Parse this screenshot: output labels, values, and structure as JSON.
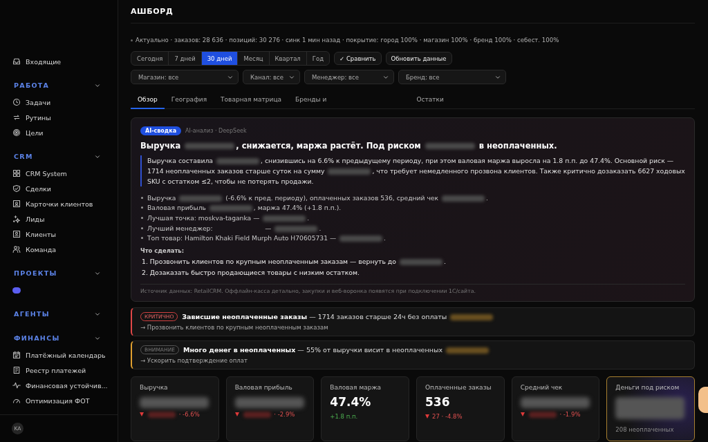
{
  "sidebar": {
    "top_items": [
      {
        "label": "Входящие"
      }
    ],
    "sections": [
      {
        "title": "РАБОТА",
        "expanded": true,
        "items": [
          {
            "label": "Задачи"
          },
          {
            "label": "Рутины"
          },
          {
            "label": "Цели"
          }
        ]
      },
      {
        "title": "CRM",
        "expanded": true,
        "items": [
          {
            "label": "CRM System"
          },
          {
            "label": "Сделки"
          },
          {
            "label": "Карточки клиентов"
          },
          {
            "label": "Лиды"
          },
          {
            "label": "Клиенты"
          },
          {
            "label": "Команда"
          }
        ]
      },
      {
        "title": "ПРОЕКТЫ",
        "expanded": true,
        "projects": [
          {
            "color": "#5b5ef0"
          }
        ]
      },
      {
        "title": "АГЕНТЫ",
        "expanded": true
      },
      {
        "title": "ФИНАНСЫ",
        "expanded": true,
        "items": [
          {
            "label": "Платёжный календарь"
          },
          {
            "label": "Реестр платежей"
          },
          {
            "label": "Финансовая устойчив..."
          },
          {
            "label": "Оптимизация ФОТ"
          }
        ]
      }
    ],
    "user": {
      "initials": "KA"
    }
  },
  "header": {
    "title": "АШБОРД"
  },
  "status_line": "Актуально · заказов: 28 636 · позиций: 30 276 · синк 1 мин назад · покрытие: город 100% · магазин 100% · бренд 100% · себест. 100%",
  "periods": [
    {
      "label": "Сегодня",
      "selected": false
    },
    {
      "label": "7 дней",
      "selected": false
    },
    {
      "label": "30 дней",
      "selected": true
    },
    {
      "label": "Месяц",
      "selected": false
    },
    {
      "label": "Квартал",
      "selected": false
    },
    {
      "label": "Год",
      "selected": false
    }
  ],
  "actions": [
    {
      "label": "✓ Сравнить"
    },
    {
      "label": "Обновить данные"
    }
  ],
  "filters": [
    {
      "value": "Магазин: все"
    },
    {
      "value": "Канал: все"
    },
    {
      "value": "Менеджер: все"
    },
    {
      "value": "Бренд: все"
    }
  ],
  "tabs": [
    {
      "label": "Обзор",
      "selected": true
    },
    {
      "label": "География",
      "selected": false
    },
    {
      "label": "Товарная матрица",
      "selected": false
    },
    {
      "label": "Бренды и",
      "selected": false
    },
    {
      "label": "Остатки",
      "selected": false
    }
  ],
  "ai_summary": {
    "badge": "AI-сводка",
    "source": "AI-анализ · DeepSeek",
    "headline": [
      {
        "text": "Выручка "
      },
      {
        "kind": "blurred"
      },
      {
        "text": ", снижается, маржа растёт. Под риском "
      },
      {
        "kind": "blurred"
      },
      {
        "text": " в неоплаченных."
      }
    ],
    "quote": [
      {
        "text": "Выручка составила "
      },
      {
        "kind": "blurred"
      },
      {
        "text": ", снизившись на 6.6% к предыдущему периоду, при этом валовая маржа выросла на 1.8 п.п. до 47.4%. Основной риск — 1714 неоплаченных заказов старше суток на сумму "
      },
      {
        "kind": "blurred"
      },
      {
        "text": ", что требует немедленного прозвона клиентов. Также критично дозаказать 6627 ходовых SKU с остатком ≤2, чтобы не потерять продажи."
      }
    ],
    "bullets": [
      [
        {
          "text": "Выручка "
        },
        {
          "kind": "blurred"
        },
        {
          "text": " (-6.6% к пред. периоду), оплаченных заказов 536, средний чек "
        },
        {
          "kind": "blurred"
        },
        {
          "text": "."
        }
      ],
      [
        {
          "text": "Валовая прибыль "
        },
        {
          "kind": "blurred"
        },
        {
          "text": ", маржа 47.4% (+1.8 п.п.)."
        }
      ],
      [
        {
          "text": "Лучшая точка: moskva-taganka — "
        },
        {
          "kind": "blurred"
        },
        {
          "text": "."
        }
      ],
      [
        {
          "text": "Лучший менеджер: "
        },
        {
          "kind": "gap"
        },
        {
          "text": " — "
        },
        {
          "kind": "blurred"
        },
        {
          "text": "."
        }
      ],
      [
        {
          "text": "Топ товар: Hamilton Khaki Field Murph Auto H70605731 — "
        },
        {
          "kind": "blurred"
        },
        {
          "text": "."
        }
      ]
    ],
    "todo_title": "Что сделать:",
    "todo": [
      [
        {
          "text": "1. Прозвонить клиентов по крупным неоплаченным заказам — вернуть до "
        },
        {
          "kind": "blurred"
        },
        {
          "text": "."
        }
      ],
      [
        {
          "text": "2. Дозаказать быстро продающиеся товары с низким остатком."
        }
      ]
    ],
    "footnote": "Источник данных: RetailCRM. Оффлайн-касса детально, закупки и веб-воронка появятся при подключении 1С/сайта."
  },
  "alerts": [
    {
      "kind": "critical",
      "tag": "КРИТИЧНО",
      "title": "Зависшие неоплаченные заказы",
      "text": [
        {
          "text": " — 1714 заказов старше 24ч без оплаты "
        },
        {
          "kind": "blurred"
        }
      ],
      "action": "→ Прозвонить клиентов по крупным неоплаченным заказам"
    },
    {
      "kind": "warning",
      "tag": "ВНИМАНИЕ",
      "title": "Много денег в неоплаченных",
      "text": [
        {
          "text": " — 55% от выручки висит в неоплаченных "
        },
        {
          "kind": "blurred"
        }
      ],
      "action": "→ Ускорить подтверждение оплат"
    }
  ],
  "kpis": [
    {
      "label": "Выручка",
      "value": [
        {
          "kind": "blurred"
        }
      ],
      "kind": "down",
      "delta": [
        {
          "kind": "blurred"
        },
        {
          "text": " · -6.6%"
        }
      ],
      "selected": false
    },
    {
      "label": "Валовая прибыль",
      "value": [
        {
          "kind": "blurred"
        }
      ],
      "kind": "down",
      "delta": [
        {
          "kind": "blurred"
        },
        {
          "text": " · -2.9%"
        }
      ],
      "selected": false
    },
    {
      "label": "Валовая маржа",
      "value": [
        {
          "text": "47.4%"
        }
      ],
      "kind": "up",
      "delta": [
        {
          "text": "+1.8 п.п."
        }
      ],
      "selected": false
    },
    {
      "label": "Оплаченные заказы",
      "value": [
        {
          "text": "536"
        }
      ],
      "kind": "down",
      "delta": [
        {
          "text": "27 · -4.8%"
        }
      ],
      "selected": false
    },
    {
      "label": "Средний чек",
      "value": [
        {
          "kind": "blurred"
        }
      ],
      "kind": "down",
      "delta": [
        {
          "kind": "blurred"
        },
        {
          "text": " · -1.9%"
        }
      ],
      "selected": false
    },
    {
      "label": "Деньги под риском",
      "value": [
        {
          "kind": "blurred"
        }
      ],
      "note": "208 неоплаченных",
      "selected": true
    }
  ]
}
